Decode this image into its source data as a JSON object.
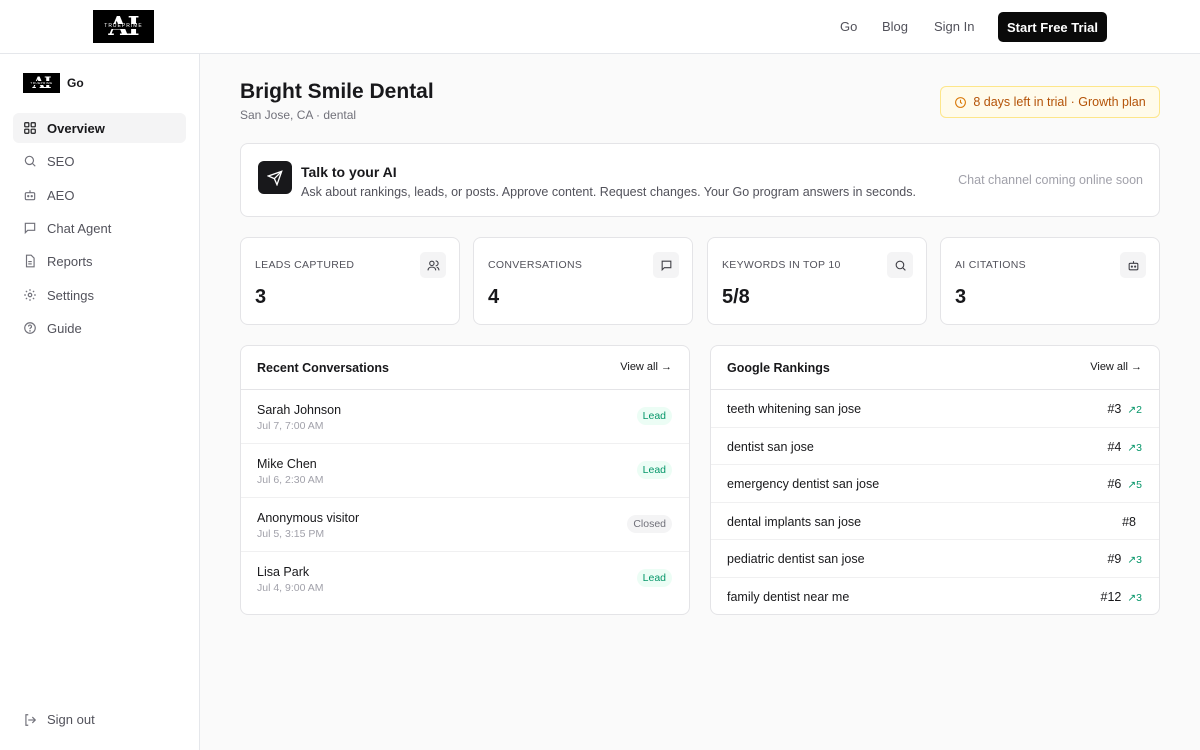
{
  "topnav": {
    "logo_text": "AI",
    "logo_subtext": "TRUEPRIME",
    "links": [
      "Go",
      "Blog",
      "Sign In"
    ],
    "cta": "Start Free Trial"
  },
  "sidebar": {
    "brand": "Go",
    "items": [
      {
        "label": "Overview",
        "icon": "grid-icon"
      },
      {
        "label": "SEO",
        "icon": "search-icon"
      },
      {
        "label": "AEO",
        "icon": "bot-icon"
      },
      {
        "label": "Chat Agent",
        "icon": "message-icon"
      },
      {
        "label": "Reports",
        "icon": "file-icon"
      },
      {
        "label": "Settings",
        "icon": "gear-icon"
      },
      {
        "label": "Guide",
        "icon": "help-icon"
      }
    ],
    "signout": "Sign out"
  },
  "header": {
    "title": "Bright Smile Dental",
    "subtitle": "San Jose, CA · dental",
    "trial": "8 days left in trial · Growth plan"
  },
  "ai_card": {
    "title": "Talk to your AI",
    "description": "Ask about rankings, leads, or posts. Approve content. Request changes. Your Go program answers in seconds.",
    "status": "Chat channel coming online soon"
  },
  "stats": [
    {
      "label": "LEADS CAPTURED",
      "value": "3",
      "icon": "users-icon"
    },
    {
      "label": "CONVERSATIONS",
      "value": "4",
      "icon": "message-icon"
    },
    {
      "label": "KEYWORDS IN TOP 10",
      "value": "5/8",
      "icon": "search-icon"
    },
    {
      "label": "AI CITATIONS",
      "value": "3",
      "icon": "bot-icon"
    }
  ],
  "conversations": {
    "title": "Recent Conversations",
    "view_all": "View all →",
    "rows": [
      {
        "name": "Sarah Johnson",
        "time": "Jul 7, 7:00 AM",
        "status": "Lead"
      },
      {
        "name": "Mike Chen",
        "time": "Jul 6, 2:30 AM",
        "status": "Lead"
      },
      {
        "name": "Anonymous visitor",
        "time": "Jul 5, 3:15 PM",
        "status": "Closed"
      },
      {
        "name": "Lisa Park",
        "time": "Jul 4, 9:00 AM",
        "status": "Lead"
      }
    ]
  },
  "rankings": {
    "title": "Google Rankings",
    "view_all": "View all →",
    "rows": [
      {
        "keyword": "teeth whitening san jose",
        "position": "#3",
        "change": "↗2"
      },
      {
        "keyword": "dentist san jose",
        "position": "#4",
        "change": "↗3"
      },
      {
        "keyword": "emergency dentist san jose",
        "position": "#6",
        "change": "↗5"
      },
      {
        "keyword": "dental implants san jose",
        "position": "#8",
        "change": ""
      },
      {
        "keyword": "pediatric dentist san jose",
        "position": "#9",
        "change": "↗3"
      },
      {
        "keyword": "family dentist near me",
        "position": "#12",
        "change": "↗3"
      }
    ]
  },
  "colors": {
    "accent": "#0a0a0a",
    "trial_text": "#b45309",
    "lead_green": "#059669"
  }
}
